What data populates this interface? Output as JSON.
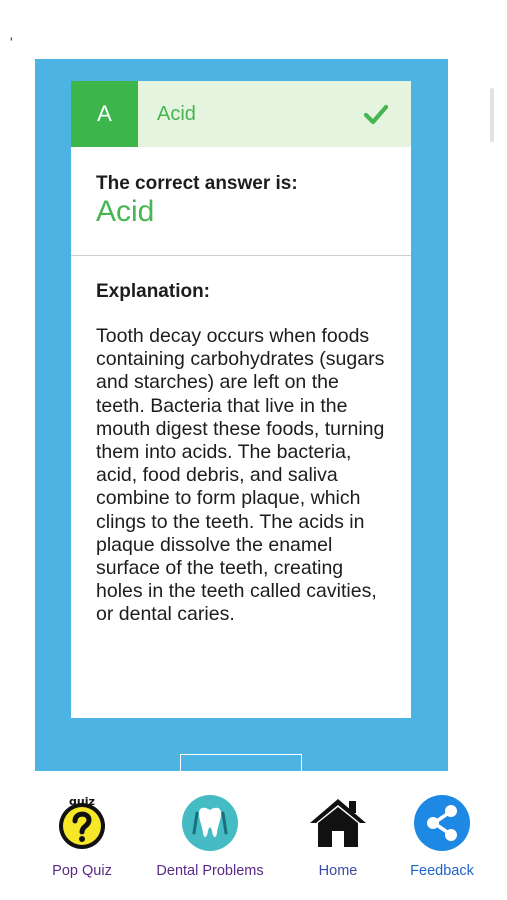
{
  "answer": {
    "letter": "A",
    "text": "Acid",
    "status_icon": "checkmark-icon"
  },
  "result": {
    "label": "The correct answer is:",
    "answer": "Acid"
  },
  "explanation": {
    "heading": "Explanation:",
    "body": "Tooth decay occurs when foods containing carbohydrates (sugars and starches) are left on the teeth. Bacteria that live in the mouth digest these foods, turning them into acids. The bacteria, acid, food debris, and saliva combine to form plaque, which clings to the teeth. The acids in plaque dissolve the enamel surface of the teeth, creating holes in the teeth called cavities, or dental caries."
  },
  "stray_mark": "'",
  "tabs": [
    {
      "label": "Pop Quiz",
      "icon": "pop-quiz-icon",
      "color": "#5b2a86"
    },
    {
      "label": "Dental Problems",
      "icon": "tooth-icon",
      "color": "#5b2a86"
    },
    {
      "label": "Home",
      "icon": "home-icon",
      "color": "#3a4aa8"
    },
    {
      "label": "Feedback",
      "icon": "share-icon",
      "color": "#1f63c9"
    }
  ],
  "colors": {
    "panel_blue": "#4db3e3",
    "correct_green": "#3cb54a",
    "answer_row_bg": "#e5f4df"
  }
}
